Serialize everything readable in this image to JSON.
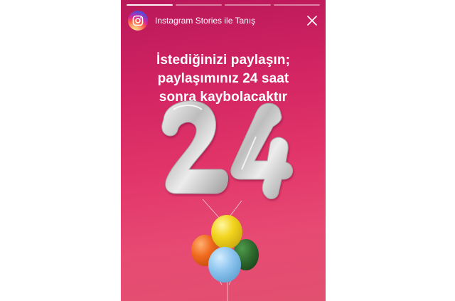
{
  "story": {
    "account_name": "Instagram Stories ile Tanış",
    "caption_lines": [
      "İstediğinizi paylaşın;",
      "paylaşımınız 24 saat",
      "sonra kaybolacaktır"
    ],
    "balloon_number": "24",
    "progress_segments": 4,
    "active_segment": 1
  },
  "icons": {
    "avatar": "instagram-logo-icon",
    "close": "close-icon"
  },
  "colors": {
    "gradient_top": "#b8185a",
    "gradient_bottom": "#e2506f",
    "text": "#ffffff",
    "balloon_silver": "#cfcfcf",
    "balloon_yellow": "#f2d51f",
    "balloon_orange": "#f06a1e",
    "balloon_green": "#2f6d2e",
    "balloon_blue": "#8cc4ee"
  }
}
